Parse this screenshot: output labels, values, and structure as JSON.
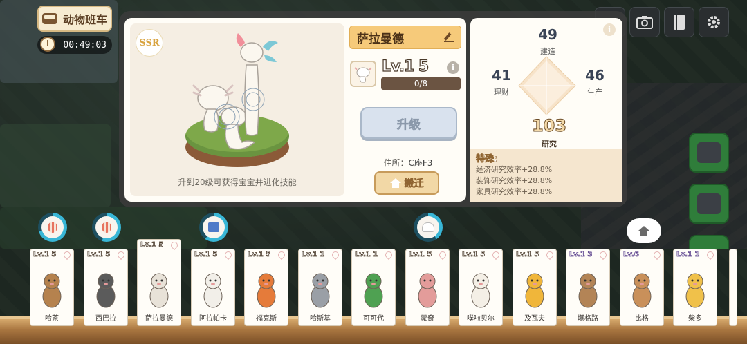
{
  "top_left": {
    "bus_label": "动物班车",
    "timer": "00:49:03"
  },
  "top_right_icons": [
    "camera-icon",
    "book-icon",
    "gear-icon"
  ],
  "animal_detail": {
    "rarity": "SSR",
    "name": "萨拉曼德",
    "level_label": "Lv.1 5",
    "xp": {
      "current": 0,
      "max": 8,
      "text": "0/8"
    },
    "upgrade_label": "升级",
    "address_label": "住所：",
    "address_value": "C座F3",
    "move_label": "搬迁",
    "portrait_note": "升到20级可获得宝宝并进化技能"
  },
  "stats": {
    "build": {
      "value": "49",
      "label": "建造"
    },
    "finance": {
      "value": "41",
      "label": "理财"
    },
    "production": {
      "value": "46",
      "label": "生产"
    },
    "research": {
      "value": "103",
      "label": "研究"
    },
    "special_title": "特殊:",
    "special_lines": [
      "经济研究效率+28.8%",
      "装饰研究效率+28.8%",
      "家具研究效率+28.8%"
    ]
  },
  "animal_cards": [
    {
      "level": "Lv.1 5",
      "name": "哈茶",
      "color": "#b5824e"
    },
    {
      "level": "Lv.1 5",
      "name": "西巴拉",
      "color": "#5b5b5b"
    },
    {
      "level": "Lv.1 5",
      "name": "萨拉曼德",
      "color": "#e8e2d8"
    },
    {
      "level": "Lv.1 5",
      "name": "阿拉帕卡",
      "color": "#f2efe9"
    },
    {
      "level": "Lv.1 5",
      "name": "福克斯",
      "color": "#e57b3a"
    },
    {
      "level": "Lv.1 1",
      "name": "哈斯基",
      "color": "#9a9fa6"
    },
    {
      "level": "Lv.1 1",
      "name": "可可代",
      "color": "#4fa152"
    },
    {
      "level": "Lv.1 5",
      "name": "蒙奇",
      "color": "#e39c9a"
    },
    {
      "level": "Lv.1 5",
      "name": "噗啦贝尔",
      "color": "#f4efe6"
    },
    {
      "level": "Lv.1 5",
      "name": "及瓦夫",
      "color": "#f0b63a"
    },
    {
      "level": "Lv.1 3",
      "name": "堪格路",
      "color": "#b38456"
    },
    {
      "level": "Lv.6",
      "name": "比格",
      "color": "#c9905a"
    },
    {
      "level": "Lv.1 1",
      "name": "柴多",
      "color": "#f0c14a"
    }
  ],
  "task_rings": [
    {
      "icon": "balloon-icon",
      "progress": 0.7
    },
    {
      "icon": "balloon-icon",
      "progress": 0.55
    },
    {
      "icon": "box-icon",
      "progress": 0.6
    },
    {
      "icon": "chef-hat-icon",
      "progress": 0.4
    }
  ]
}
